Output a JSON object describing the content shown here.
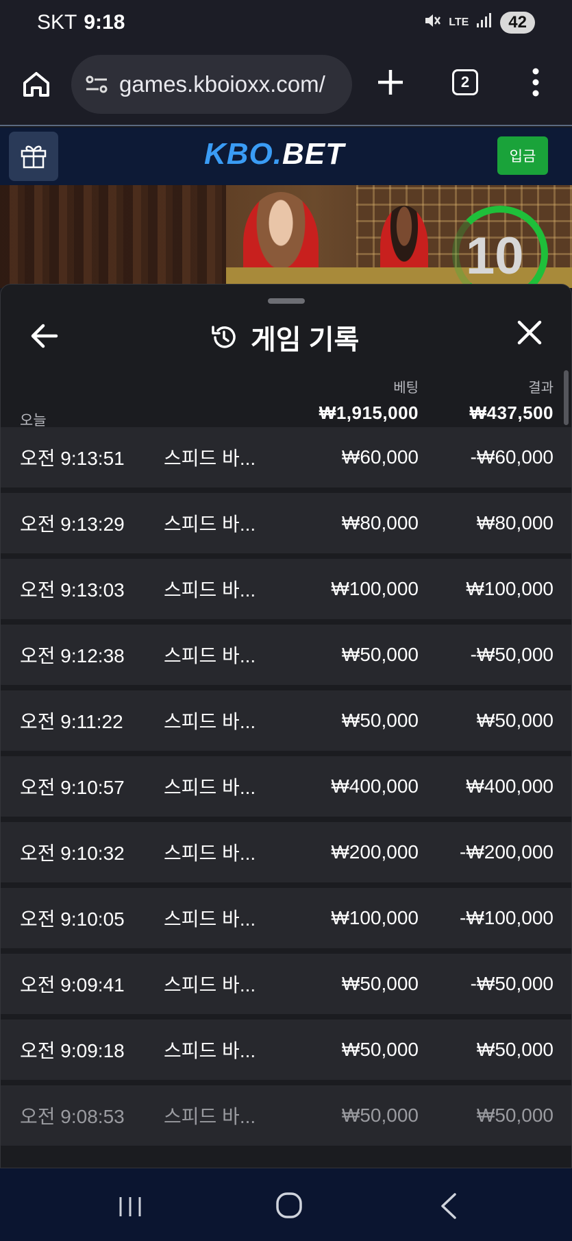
{
  "status_bar": {
    "carrier": "SKT",
    "time": "9:18",
    "network": "LTE",
    "battery": "42"
  },
  "browser": {
    "url": "games.kboioxx.com/",
    "tab_count": "2"
  },
  "site": {
    "logo_kbo": "KBO",
    "logo_dot": ".",
    "logo_bet": "BET",
    "deposit_label": "입금"
  },
  "video": {
    "countdown": "10"
  },
  "panel": {
    "title": "게임 기록",
    "today_label": "오늘",
    "bet_header": "베팅",
    "result_header": "결과",
    "total_bet": "₩1,915,000",
    "total_result": "₩437,500",
    "rows": [
      {
        "time": "오전 9:13:51",
        "game": "스피드 바...",
        "bet": "₩60,000",
        "result": "-₩60,000"
      },
      {
        "time": "오전 9:13:29",
        "game": "스피드 바...",
        "bet": "₩80,000",
        "result": "₩80,000"
      },
      {
        "time": "오전 9:13:03",
        "game": "스피드 바...",
        "bet": "₩100,000",
        "result": "₩100,000"
      },
      {
        "time": "오전 9:12:38",
        "game": "스피드 바...",
        "bet": "₩50,000",
        "result": "-₩50,000"
      },
      {
        "time": "오전 9:11:22",
        "game": "스피드 바...",
        "bet": "₩50,000",
        "result": "₩50,000"
      },
      {
        "time": "오전 9:10:57",
        "game": "스피드 바...",
        "bet": "₩400,000",
        "result": "₩400,000"
      },
      {
        "time": "오전 9:10:32",
        "game": "스피드 바...",
        "bet": "₩200,000",
        "result": "-₩200,000"
      },
      {
        "time": "오전 9:10:05",
        "game": "스피드 바...",
        "bet": "₩100,000",
        "result": "-₩100,000"
      },
      {
        "time": "오전 9:09:41",
        "game": "스피드 바...",
        "bet": "₩50,000",
        "result": "-₩50,000"
      },
      {
        "time": "오전 9:09:18",
        "game": "스피드 바...",
        "bet": "₩50,000",
        "result": "₩50,000"
      },
      {
        "time": "오전 9:08:53",
        "game": "스피드 바...",
        "bet": "₩50,000",
        "result": "₩50,000"
      }
    ]
  },
  "colors": {
    "accent_blue": "#3a9cf5",
    "deposit_green": "#1aa33a",
    "timer_green": "#1fbf3a"
  }
}
